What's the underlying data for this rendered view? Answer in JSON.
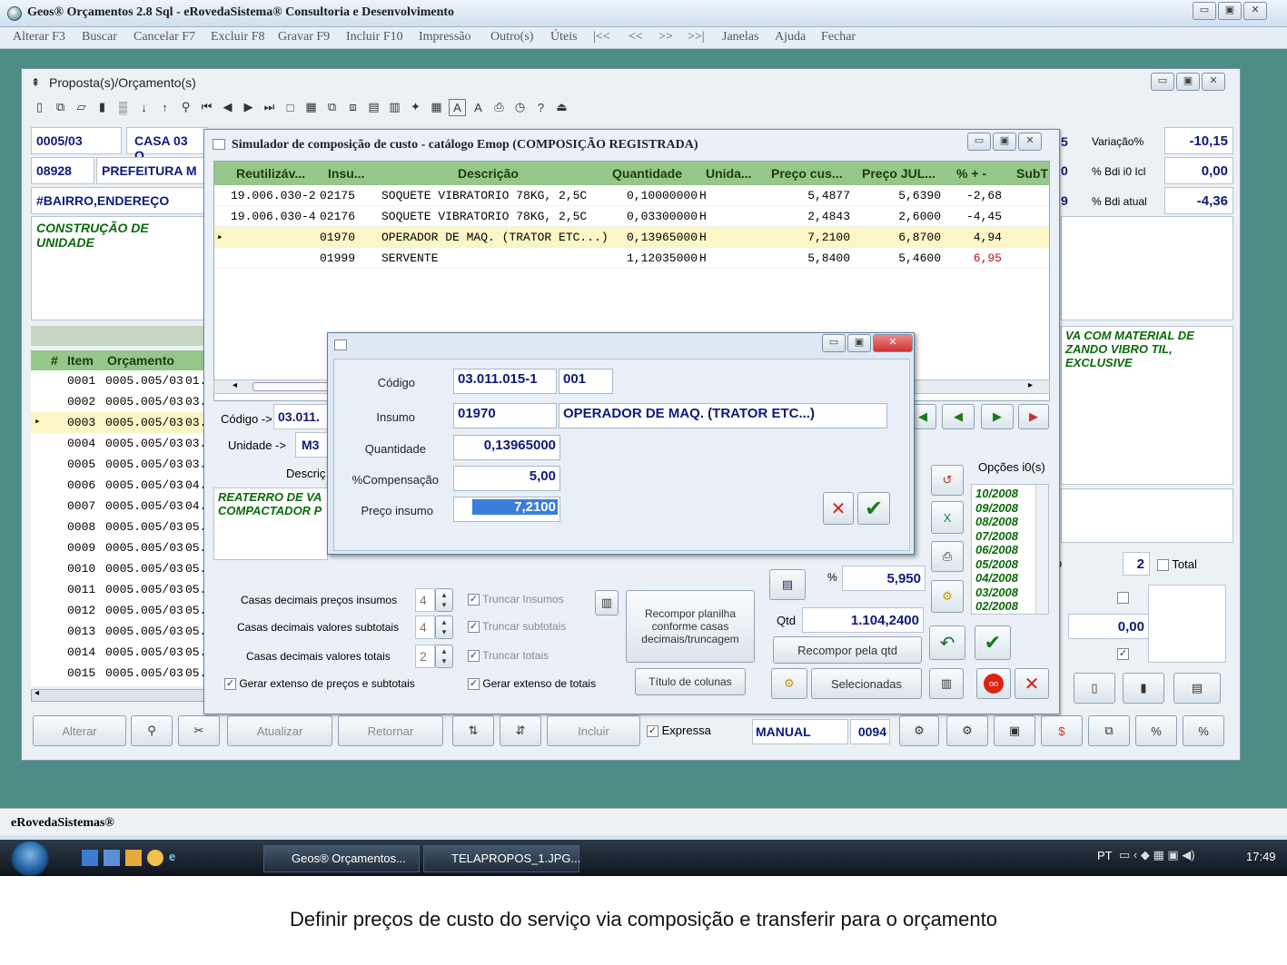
{
  "app": {
    "title": "Geos® Orçamentos 2.8 Sql - eRovedaSistema® Consultoria e Desenvolvimento",
    "menu": [
      "Alterar F3",
      "Buscar",
      "Cancelar F7",
      "Excluir F8",
      "Gravar F9",
      "Incluir F10",
      "Impressão",
      "Outro(s)",
      "Úteis",
      "|<<",
      "<<",
      ">>",
      ">>|",
      "Janelas",
      "Ajuda",
      "Fechar"
    ],
    "status": "eRovedaSistemas®"
  },
  "proposta": {
    "title": "Proposta(s)/Orçamento(s)",
    "code": "0005/03",
    "name": "CASA 03 Q",
    "client_code": "08928",
    "client_name": "PREFEITURA M",
    "address": "#BAIRRO,ENDEREÇO",
    "description": "CONSTRUÇÃO DE UNIDADE",
    "variacao_label": "Variação%",
    "variacao_value": "-10,15",
    "variacao_num": "5",
    "bdi_icl_label": "% Bdi i0 Icl",
    "bdi_icl_value": "0,00",
    "bdi_icl_num": "0",
    "bdi_atual_label": "% Bdi atual",
    "bdi_atual_value": "-4,36",
    "bdi_atual_num": "9",
    "right_text": "VA COM MATERIAL DE ZANDO VIBRO TIL, EXCLUSIVE",
    "grid_headers": [
      "#",
      "Item",
      "Orçamento"
    ],
    "rows": [
      {
        "item": "0001",
        "orc": "0005.005/03",
        "ext": "01."
      },
      {
        "item": "0002",
        "orc": "0005.005/03",
        "ext": "03."
      },
      {
        "item": "0003",
        "orc": "0005.005/03",
        "ext": "03."
      },
      {
        "item": "0004",
        "orc": "0005.005/03",
        "ext": "03."
      },
      {
        "item": "0005",
        "orc": "0005.005/03",
        "ext": "03."
      },
      {
        "item": "0006",
        "orc": "0005.005/03",
        "ext": "04."
      },
      {
        "item": "0007",
        "orc": "0005.005/03",
        "ext": "04."
      },
      {
        "item": "0008",
        "orc": "0005.005/03",
        "ext": "05."
      },
      {
        "item": "0009",
        "orc": "0005.005/03",
        "ext": "05."
      },
      {
        "item": "0010",
        "orc": "0005.005/03",
        "ext": "05."
      },
      {
        "item": "0011",
        "orc": "0005.005/03",
        "ext": "05."
      },
      {
        "item": "0012",
        "orc": "0005.005/03",
        "ext": "05."
      },
      {
        "item": "0013",
        "orc": "0005.005/03",
        "ext": "05."
      },
      {
        "item": "0014",
        "orc": "0005.005/03",
        "ext": "05."
      },
      {
        "item": "0015",
        "orc": "0005.005/03",
        "ext": "05."
      }
    ],
    "qty_value": "2",
    "total_label": "Total",
    "bottom_value": "0,00",
    "bottom_buttons": {
      "alterar": "Alterar",
      "atualizar": "Atualizar",
      "retornar": "Retornar",
      "incluir": "Incluir",
      "expressa": "Expressa",
      "manual": "MANUAL",
      "manual_code": "0094"
    }
  },
  "simulador": {
    "title": "Simulador de composição de custo - catálogo Emop (COMPOSIÇÃO REGISTRADA)",
    "headers": [
      "Reutilizáv...",
      "Insu...",
      "Descrição",
      "Quantidade",
      "Unida...",
      "Preço cus...",
      "Preço JUL...",
      "% + -",
      "SubT"
    ],
    "rows": [
      {
        "reut": "19.006.030-2",
        "insumo": "02175",
        "desc": "SOQUETE VIBRATORIO 78KG, 2,5C",
        "qtd": "0,10000000",
        "un": "H",
        "pc": "5,4877",
        "pj": "5,6390",
        "pct": "-2,68",
        "neg": false
      },
      {
        "reut": "19.006.030-4",
        "insumo": "02176",
        "desc": "SOQUETE VIBRATORIO 78KG, 2,5C",
        "qtd": "0,03300000",
        "un": "H",
        "pc": "2,4843",
        "pj": "2,6000",
        "pct": "-4,45",
        "neg": false
      },
      {
        "reut": "",
        "insumo": "01970",
        "desc": "OPERADOR DE MAQ. (TRATOR ETC...)",
        "qtd": "0,13965000",
        "un": "H",
        "pc": "7,2100",
        "pj": "6,8700",
        "pct": "4,94",
        "neg": false
      },
      {
        "reut": "",
        "insumo": "01999",
        "desc": "SERVENTE",
        "qtd": "1,12035000",
        "un": "H",
        "pc": "5,8400",
        "pj": "5,4600",
        "pct": "6,95",
        "neg": true
      }
    ],
    "codigo_label": "Código ->",
    "codigo_value": "03.011.",
    "unidade_label": "Unidade ->",
    "unidade_value": "M3",
    "descricao_label": "Descriç",
    "green_text": "REATERRO DE VA COMPACTADOR P",
    "opcoes_label": "Opções i0(s)",
    "opcoes": [
      "10/2008",
      "09/2008",
      "08/2008",
      "07/2008",
      "06/2008",
      "05/2008",
      "04/2008",
      "03/2008",
      "02/2008"
    ],
    "pct_symbol": "%",
    "pct_value": "5,950",
    "qtd_label": "Qtd",
    "qtd_value": "1.104,2400",
    "casas_precos_label": "Casas decimais preços insumos",
    "casas_precos_value": "4",
    "casas_subtotais_label": "Casas decimais valores subtotais",
    "casas_subtotais_value": "4",
    "casas_totais_label": "Casas decimais valores totais",
    "casas_totais_value": "2",
    "truncar_insumos": "Truncar Insumos",
    "truncar_subtotais": "Truncar subtotais",
    "truncar_totais": "Truncar totais",
    "gerar_precos": "Gerar extenso de preços e subtotais",
    "gerar_totais": "Gerar extenso de totais",
    "recompor_planilha": "Recompor planilha conforme casas decimais/truncagem",
    "titulo_colunas": "Título de colunas",
    "recompor_qtd": "Recompor pela qtd",
    "selecionadas": "Selecionadas"
  },
  "dialog": {
    "codigo_label": "Código",
    "codigo_value": "03.011.015-1",
    "codigo_sub": "001",
    "insumo_label": "Insumo",
    "insumo_value": "01970",
    "insumo_desc": "OPERADOR DE MAQ. (TRATOR ETC...)",
    "quantidade_label": "Quantidade",
    "quantidade_value": "0,13965000",
    "compensacao_label": "%Compensação",
    "compensacao_value": "5,00",
    "preco_label": "Preço insumo",
    "preco_value": "7,2100"
  },
  "taskbar": {
    "btn1": "Geos® Orçamentos...",
    "btn2": "TELAPROPOS_1.JPG...",
    "lang": "PT",
    "clock": "17:49"
  },
  "caption": "Definir preços de custo do serviço via composição e transferir para o orçamento",
  "colors": {
    "grid_header": "#95c68a",
    "highlight_row": "#fbf6c6",
    "desktop": "#4e8c86",
    "negative": "#c01010"
  }
}
